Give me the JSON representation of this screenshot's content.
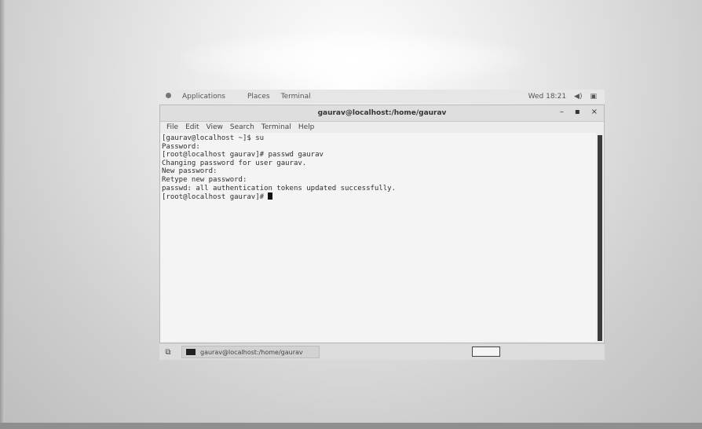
{
  "top_bar": {
    "applications": "Applications",
    "places": "Places",
    "terminal": "Terminal",
    "clock": "Wed 18:21",
    "volume_icon": "volume-icon",
    "battery_icon": "battery-icon"
  },
  "window": {
    "title": "gaurav@localhost:/home/gaurav",
    "minimize": "–",
    "maximize": "▪",
    "close": "×"
  },
  "menubar": {
    "items": [
      "File",
      "Edit",
      "View",
      "Search",
      "Terminal",
      "Help"
    ]
  },
  "terminal": {
    "lines": [
      "[gaurav@localhost ~]$ su",
      "Password:",
      "[root@localhost gaurav]# passwd gaurav",
      "Changing password for user gaurav.",
      "New password:",
      "Retype new password:",
      "passwd: all authentication tokens updated successfully.",
      "[root@localhost gaurav]# "
    ]
  },
  "taskbar": {
    "task_label": "gaurav@localhost:/home/gaurav"
  },
  "colors": {
    "terminal_bg": "#f4f4f4",
    "terminal_fg": "#2e2e2e",
    "scrollbar": "#3a3a3a"
  }
}
